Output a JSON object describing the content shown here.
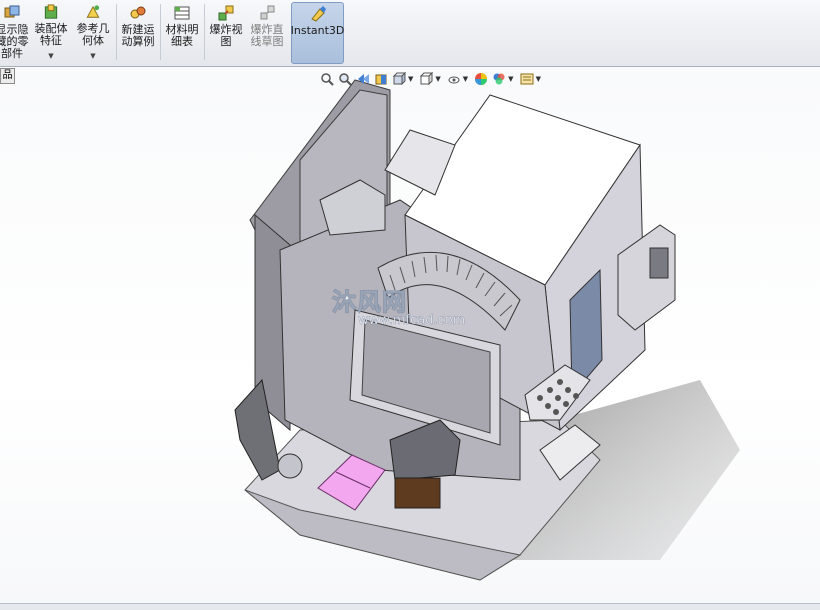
{
  "toolbar": {
    "items": [
      {
        "label": "显示隐\n藏的零\n部件",
        "icon": "show-hide-components-icon"
      },
      {
        "label": "装配体\n特征",
        "icon": "assembly-features-icon"
      },
      {
        "label": "参考几\n何体",
        "icon": "reference-geometry-icon"
      },
      {
        "label": "新建运\n动算例",
        "icon": "new-motion-study-icon"
      },
      {
        "label": "材料明\n细表",
        "icon": "bill-of-materials-icon"
      },
      {
        "label": "爆炸视\n图",
        "icon": "exploded-view-icon"
      },
      {
        "label": "爆炸直\n线草图",
        "icon": "explode-line-sketch-icon"
      },
      {
        "label": "Instant3D",
        "icon": "instant3d-icon"
      }
    ]
  },
  "left_tab": {
    "label": "品"
  },
  "heads_up_toolbar": {
    "icons": [
      "zoom-to-fit-icon",
      "zoom-area-icon",
      "previous-view-icon",
      "section-view-icon",
      "view-orientation-icon",
      "display-style-icon",
      "hide-show-items-icon",
      "edit-appearance-icon",
      "apply-scene-icon",
      "view-settings-icon"
    ]
  },
  "watermark": {
    "cn": "沐风网",
    "en": "www.mfcad.com"
  }
}
